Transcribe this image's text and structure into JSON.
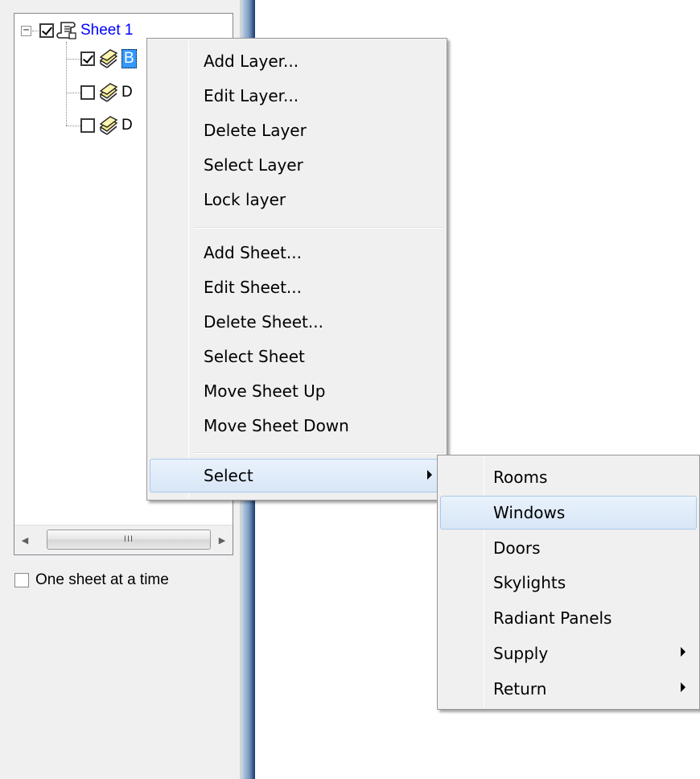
{
  "tree": {
    "sheet_label": "Sheet 1",
    "expander_symbol": "−",
    "layers": [
      {
        "label": "B",
        "checked": true,
        "selected": true
      },
      {
        "label": "D",
        "checked": false,
        "selected": false
      },
      {
        "label": "D",
        "checked": false,
        "selected": false
      }
    ]
  },
  "scrollbar": {
    "left_arrow": "◀",
    "right_arrow": "▶",
    "thumb_grip": "III"
  },
  "one_sheet_checkbox": {
    "label": "One sheet at a time",
    "checked": false
  },
  "context_menu": {
    "group1": [
      "Add Layer...",
      "Edit Layer...",
      "Delete Layer",
      "Select Layer",
      "Lock layer"
    ],
    "group2": [
      "Add Sheet...",
      "Edit Sheet...",
      "Delete Sheet...",
      "Select Sheet",
      "Move Sheet Up",
      "Move Sheet Down"
    ],
    "group3": [
      "Select"
    ],
    "highlighted": "Select"
  },
  "submenu": {
    "items": [
      "Rooms",
      "Windows",
      "Doors",
      "Skylights",
      "Radiant Panels",
      "Supply",
      "Return"
    ],
    "highlighted": "Windows",
    "has_submenu": [
      "Supply",
      "Return"
    ]
  },
  "colors": {
    "sheet_text": "#0000ff",
    "selection": "#3399ff",
    "menu_bg": "#f0f0f0",
    "highlight_border": "#a8c8ec"
  }
}
